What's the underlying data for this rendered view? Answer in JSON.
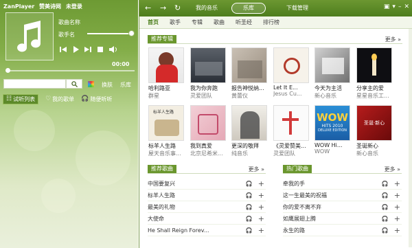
{
  "app": {
    "name": "ZanPlayer",
    "site": "赞美诗网",
    "login": "未登录"
  },
  "player": {
    "song_name": "歌曲名称",
    "singer": "歌手名",
    "time": "00:00",
    "volume": 1.0,
    "progress": 0.0
  },
  "search": {
    "value": "",
    "placeholder": ""
  },
  "left_tools": {
    "skin_label": "换肤",
    "library_label": "乐库"
  },
  "left_tabs": [
    {
      "label": "试听列表"
    },
    {
      "label": "我的歌单"
    },
    {
      "label": "随便听听"
    }
  ],
  "top_tabs": {
    "my_music": "我的音乐",
    "library": "乐库",
    "download": "下载管理"
  },
  "sub_nav": [
    "首页",
    "歌手",
    "专辑",
    "歌曲",
    "听圣经",
    "排行榜"
  ],
  "sections": {
    "albums_title": "推荐专辑",
    "songs_title": "推荐歌曲",
    "hot_title": "热门歌曲",
    "more": "更多 »"
  },
  "albums": [
    {
      "title": "哈利路亚",
      "artist": "群星"
    },
    {
      "title": "我为你奔跑",
      "artist": "灵爱团队"
    },
    {
      "title": "报告神悦纳...",
      "artist": "黄蕾仪"
    },
    {
      "title": "Let It E...",
      "artist": "Jesus Cu..."
    },
    {
      "title": "今天为主活",
      "artist": "新心音乐"
    },
    {
      "title": "分享主的爱",
      "artist": "星星音乐工..."
    },
    {
      "title": "标羊人生路",
      "artist": "屋天音乐事..."
    },
    {
      "title": "我到真爱",
      "artist": "北京尼希米..."
    },
    {
      "title": "更深的敬拜",
      "artist": "纯音乐"
    },
    {
      "title": "《灵爱赞美...",
      "artist": "灵爱团队"
    },
    {
      "title": "WOW Hi...",
      "artist": "WOW"
    },
    {
      "title": "圣诞新心",
      "artist": "新心音乐"
    }
  ],
  "cover_art": {
    "wow": "WOW",
    "wow_sub": "HITS 2010",
    "wow_deluxe": "DELUXE EDITION",
    "biaoyang": "标羊人生路",
    "xmas": "圣诞·新心"
  },
  "recommended_songs": [
    "中国要复兴",
    "标羊人生路",
    "最美的礼物",
    "大使命",
    "He Shall Reign Forev..."
  ],
  "hot_songs": [
    "牵我的手",
    "这一生最美的祝福",
    "你的爱不离不弃",
    "如鹰展翅上腾",
    "永生的路"
  ],
  "colors": {
    "accent": "#6a962d",
    "topbar": "#4d7d1d"
  }
}
